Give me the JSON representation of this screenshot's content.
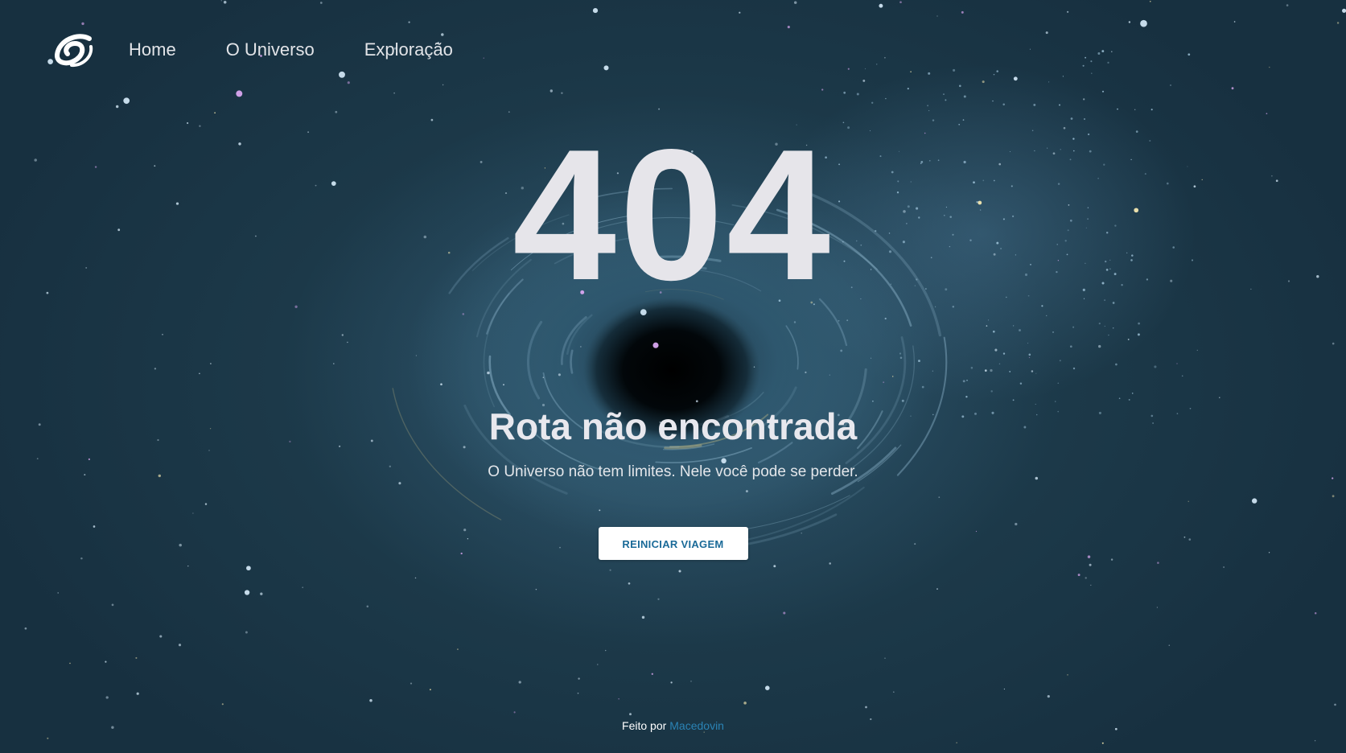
{
  "nav": {
    "logo_icon": "galaxy-swirl-icon",
    "links": [
      {
        "label": "Home"
      },
      {
        "label": "O Universo"
      },
      {
        "label": "Exploração"
      }
    ]
  },
  "error": {
    "code": "404",
    "title": "Rota não encontrada",
    "message": "O Universo não tem limites. Nele você pode se perder.",
    "button_label": "REINICIAR VIAGEM"
  },
  "footer": {
    "made_by": "Feito por",
    "author": "Macedovin"
  },
  "colors": {
    "background": "#1d3846",
    "text": "#e6e5ea",
    "button_text": "#1a6a98",
    "link": "#2a83b5"
  }
}
